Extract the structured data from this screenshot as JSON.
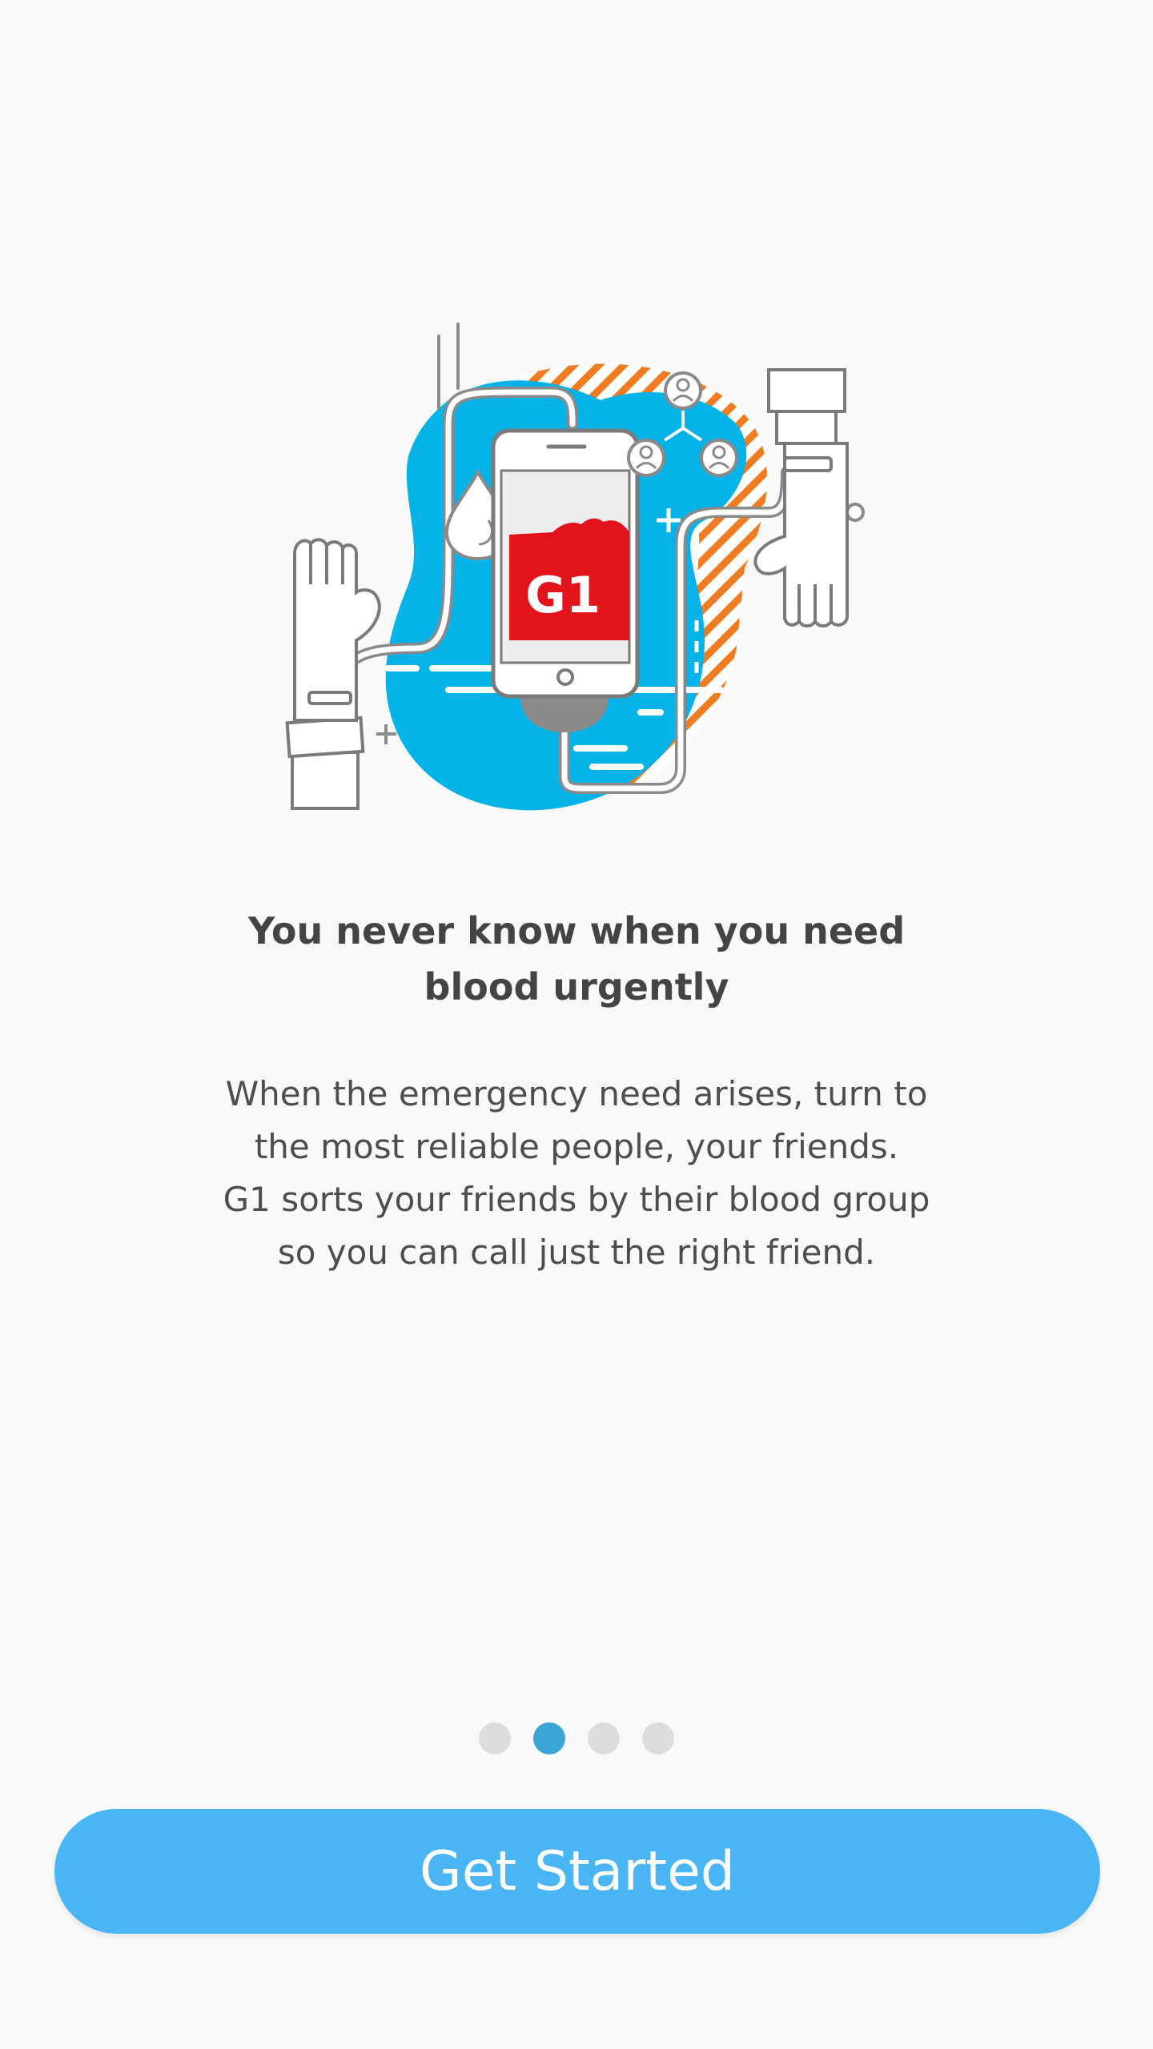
{
  "illustration": {
    "icon": "blood-donation-phone-illustration",
    "logo_text": "G1",
    "colors": {
      "blob": "#03b2e6",
      "stripes": "#f07c22",
      "logo_red": "#e3131c",
      "outline": "#7a7a7a"
    }
  },
  "onboarding": {
    "headline_line1": "You never know when you need",
    "headline_line2": "blood urgently",
    "body_line1": "When the emergency need arises, turn to",
    "body_line2": "the most reliable people, your friends.",
    "body_line3": "G1 sorts your friends by their blood group",
    "body_line4": "so you can call just the right friend."
  },
  "pager": {
    "page_count": 4,
    "active_page": 2,
    "active_color": "#3aa6d8",
    "inactive_color": "#dcdcdc"
  },
  "cta": {
    "label": "Get Started",
    "color": "#4ab5f5"
  }
}
